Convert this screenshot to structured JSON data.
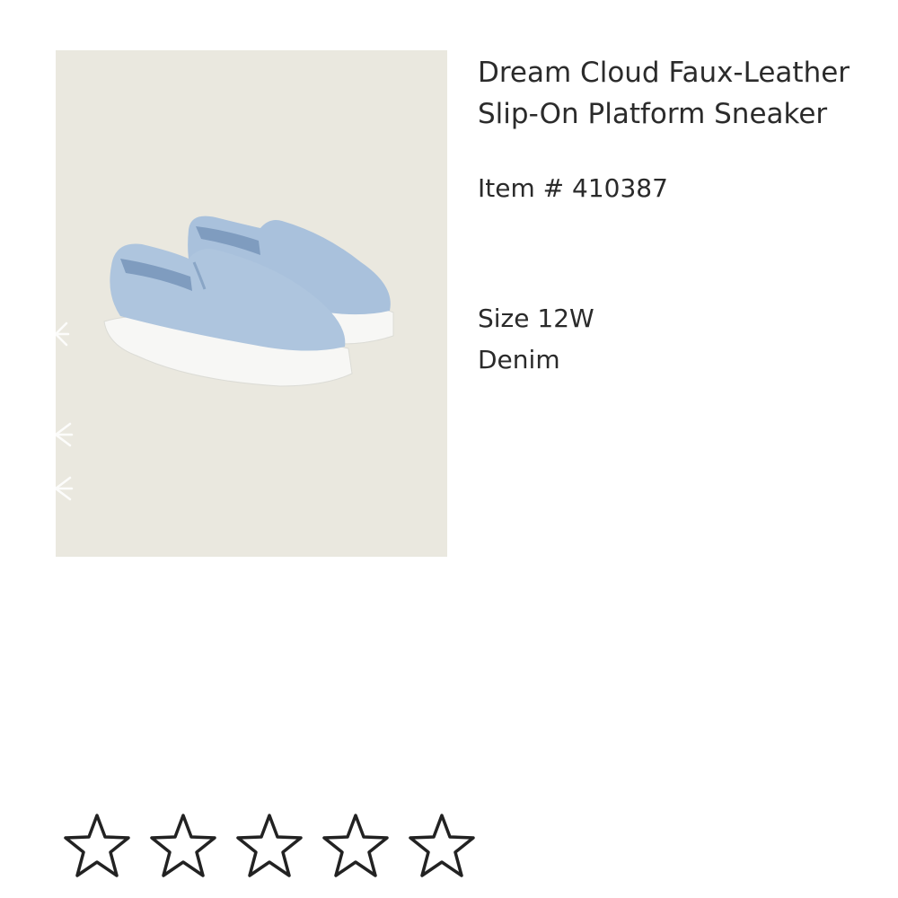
{
  "product": {
    "title_line1": "Dream Cloud Faux-Leather",
    "title_line2": "Slip-On Platform Sneaker",
    "item_number": "Item # 410387",
    "size": "Size 12W",
    "color": "Denim",
    "image_background": "#eae8df",
    "shoe_color": "#a9c1dc",
    "sole_color": "#f7f7f5"
  },
  "rating": {
    "value": 0,
    "max": 5,
    "star_icon": "star-outline-icon"
  }
}
